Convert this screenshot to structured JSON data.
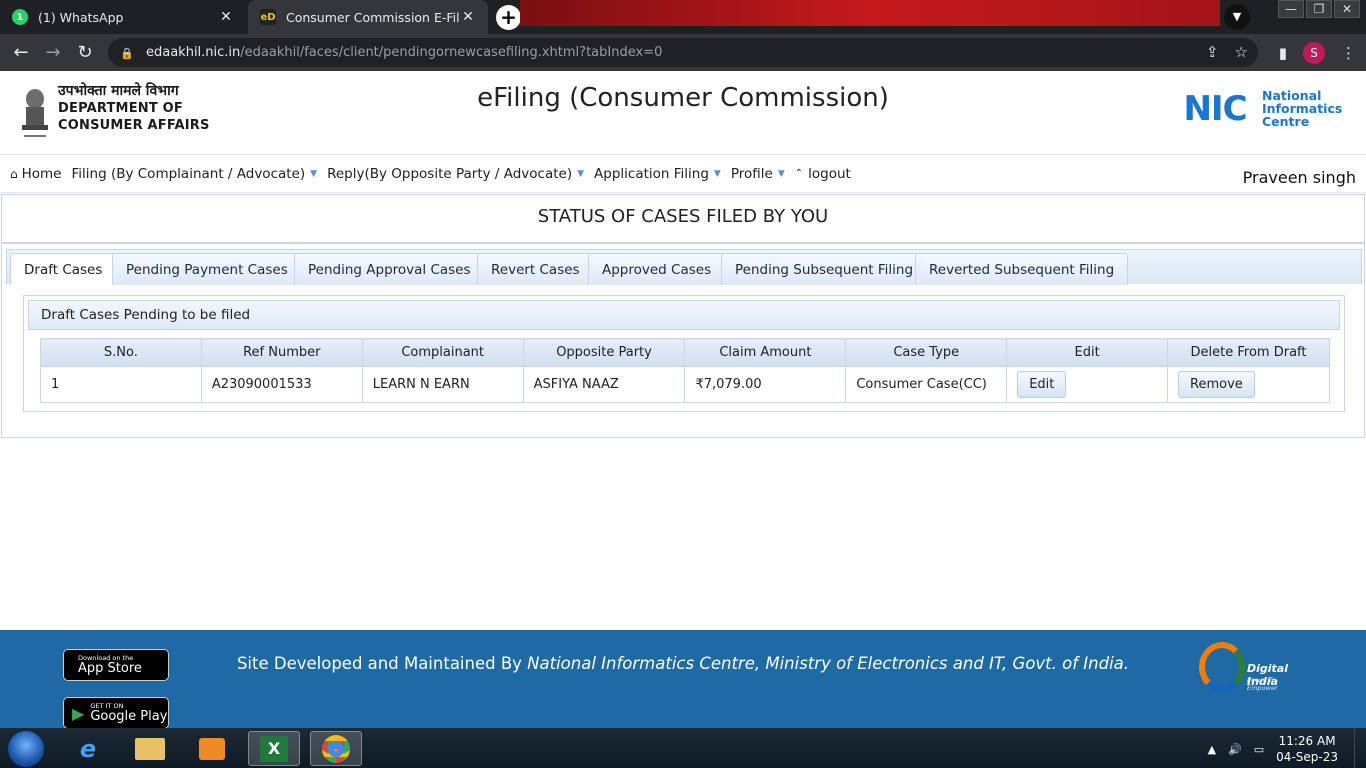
{
  "browser": {
    "tabs": [
      {
        "title": "(1) WhatsApp",
        "favicon": "whatsapp-icon",
        "active": false
      },
      {
        "title": "Consumer Commission E-Filing A",
        "favicon": "edaakhil-icon",
        "active": true
      }
    ],
    "favicon_whatsapp_glyph": "1",
    "favicon_edaakhil_glyph": "eD",
    "address": {
      "host": "edaakhil.nic.in",
      "path": "/edaakhil/faces/client/pendingornewcasefiling.xhtml?tabIndex=0"
    },
    "profile_initial": "S"
  },
  "header": {
    "dept_hindi": "उपभोक्ता मामले विभाग",
    "dept_line1": "DEPARTMENT OF",
    "dept_line2": "CONSUMER AFFAIRS",
    "site_title": "eFiling (Consumer Commission)",
    "nic_mark": "NIC",
    "nic_text": [
      "National",
      "Informatics",
      "Centre"
    ]
  },
  "menu": {
    "items": [
      {
        "label": "Home",
        "icon": "home-icon",
        "has_caret": false
      },
      {
        "label": "Filing (By Complainant / Advocate)",
        "has_caret": true
      },
      {
        "label": "Reply(By Opposite Party / Advocate)",
        "has_caret": true
      },
      {
        "label": "Application Filing",
        "has_caret": true
      },
      {
        "label": "Profile",
        "has_caret": true
      },
      {
        "label": "logout",
        "icon": "logout-icon",
        "has_caret": false
      }
    ],
    "username": "Praveen singh"
  },
  "content": {
    "heading": "STATUS OF CASES FILED BY YOU",
    "tabs": [
      "Draft Cases",
      "Pending Payment Cases",
      "Pending Approval Cases",
      "Revert Cases",
      "Approved Cases",
      "Pending Subsequent Filing",
      "Reverted Subsequent Filing"
    ],
    "selected_tab": "Draft Cases",
    "panel_title": "Draft Cases Pending to be filed",
    "columns": [
      "S.No.",
      "Ref Number",
      "Complainant",
      "Opposite Party",
      "Claim Amount",
      "Case Type",
      "Edit",
      "Delete From Draft"
    ],
    "rows": [
      {
        "sno": "1",
        "ref": "A23090001533",
        "complainant": "LEARN N EARN",
        "opposite": "ASFIYA NAAZ",
        "amount": "₹7,079.00",
        "case_type": "Consumer Case(CC)",
        "edit_label": "Edit",
        "remove_label": "Remove"
      }
    ]
  },
  "footer": {
    "app_store_sub": "Download on the",
    "app_store_main": "App Store",
    "google_play_sub": "GET IT ON",
    "google_play_main": "Google Play",
    "text_plain": "Site Developed and Maintained By ",
    "text_italic": "National Informatics Centre, Ministry of Electronics and IT, Govt. of India.",
    "digital_india": "Digital India",
    "digital_india_tag": "Power To Empower"
  },
  "taskbar": {
    "time": "11:26 AM",
    "date": "04-Sep-23",
    "apps": [
      "ie-icon",
      "file-explorer-icon",
      "media-player-icon",
      "excel-icon",
      "chrome-icon"
    ],
    "excel_glyph": "X"
  },
  "colors": {
    "footer_bg": "#1d6aa5",
    "accent": "#1976d2",
    "tab_border": "#c7d6e8"
  }
}
